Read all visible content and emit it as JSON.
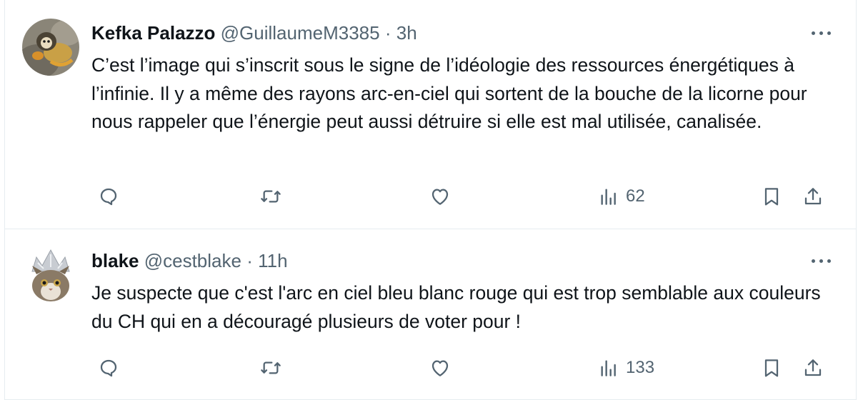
{
  "tweets": [
    {
      "display_name": "Kefka Palazzo",
      "handle": "@GuillaumeM3385",
      "separator": "·",
      "time": "3h",
      "text": "C’est l’image qui s’inscrit sous le signe de l’idéologie des ressources énergétiques à l’infinie. Il y a même des rayons arc-en-ciel qui sortent de la bouche de la licorne pour nous rappeler que l’énergie peut aussi détruire si elle est mal utilisée, canalisée.",
      "views": "62",
      "avatar_icon": "monkey-avatar"
    },
    {
      "display_name": "blake",
      "handle": "@cestblake",
      "separator": "·",
      "time": "11h",
      "text": "Je suspecte que c'est l'arc en ciel bleu blanc rouge qui est trop semblable aux couleurs du CH qui en a découragé plusieurs de voter pour !",
      "views": "133",
      "avatar_icon": "cat-foil-hat-avatar"
    }
  ],
  "colors": {
    "text_primary": "#0f1419",
    "text_secondary": "#536471",
    "divider": "#e6ecf0"
  }
}
